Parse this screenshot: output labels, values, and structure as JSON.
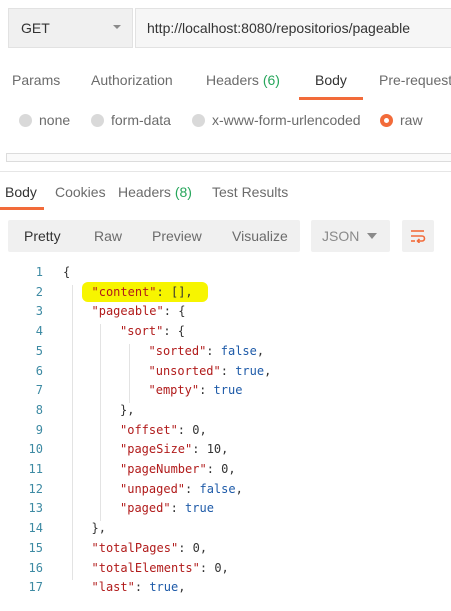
{
  "request": {
    "method": "GET",
    "url": "http://localhost:8080/repositorios/pageable"
  },
  "request_tabs": [
    {
      "label": "Params"
    },
    {
      "label": "Authorization"
    },
    {
      "label": "Headers",
      "count": "(6)"
    },
    {
      "label": "Body",
      "active": true
    },
    {
      "label": "Pre-request"
    }
  ],
  "body_types": [
    {
      "label": "none",
      "selected": false
    },
    {
      "label": "form-data",
      "selected": false
    },
    {
      "label": "x-www-form-urlencoded",
      "selected": false
    },
    {
      "label": "raw",
      "selected": true
    }
  ],
  "response_tabs": [
    {
      "label": "Body",
      "active": true
    },
    {
      "label": "Cookies"
    },
    {
      "label": "Headers",
      "count": "(8)"
    },
    {
      "label": "Test Results"
    }
  ],
  "view_modes": [
    "Pretty",
    "Raw",
    "Preview",
    "Visualize"
  ],
  "active_view": "Pretty",
  "format": "JSON",
  "colors": {
    "accent": "#f26b3a",
    "count_green": "#26a65b",
    "json_key": "#b11b1b",
    "json_bool": "#1d5aa8",
    "line_number": "#3d8aa3",
    "highlight": "#f7f500"
  },
  "code_lines": [
    {
      "n": "1",
      "text": "{"
    },
    {
      "n": "2",
      "key": "\"content\"",
      "rest": ": [],"
    },
    {
      "n": "3",
      "key": "\"pageable\"",
      "rest": ": {"
    },
    {
      "n": "4",
      "key": "\"sort\"",
      "rest": ": {"
    },
    {
      "n": "5",
      "key": "\"sorted\"",
      "sep": ": ",
      "val": "false",
      "end": ","
    },
    {
      "n": "6",
      "key": "\"unsorted\"",
      "sep": ": ",
      "val": "true",
      "end": ","
    },
    {
      "n": "7",
      "key": "\"empty\"",
      "sep": ": ",
      "val": "true",
      "end": ""
    },
    {
      "n": "8",
      "text": "},"
    },
    {
      "n": "9",
      "key": "\"offset\"",
      "rest": ": 0,"
    },
    {
      "n": "10",
      "key": "\"pageSize\"",
      "rest": ": 10,"
    },
    {
      "n": "11",
      "key": "\"pageNumber\"",
      "rest": ": 0,"
    },
    {
      "n": "12",
      "key": "\"unpaged\"",
      "sep": ": ",
      "val": "false",
      "end": ","
    },
    {
      "n": "13",
      "key": "\"paged\"",
      "sep": ": ",
      "val": "true",
      "end": ""
    },
    {
      "n": "14",
      "text": "},"
    },
    {
      "n": "15",
      "key": "\"totalPages\"",
      "rest": ": 0,"
    },
    {
      "n": "16",
      "key": "\"totalElements\"",
      "rest": ": 0,"
    },
    {
      "n": "17",
      "key": "\"last\"",
      "sep": ": ",
      "val": "true",
      "end": ","
    }
  ]
}
